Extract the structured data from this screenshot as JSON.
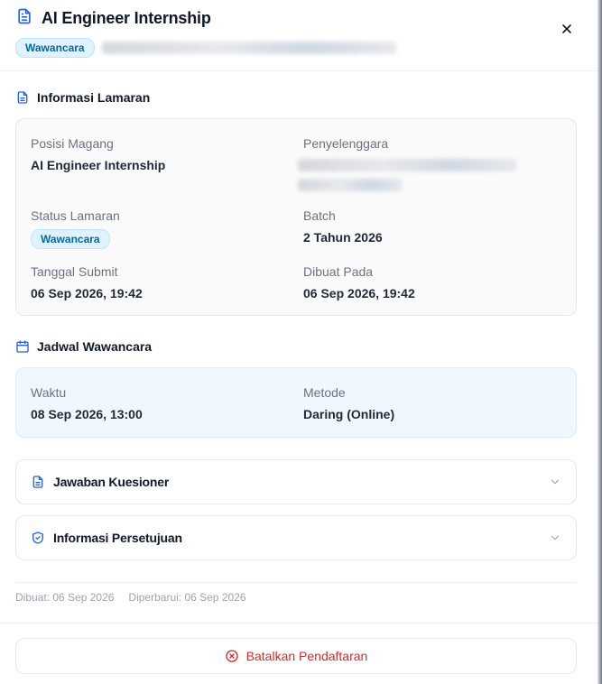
{
  "header": {
    "title": "AI Engineer Internship",
    "status_badge": "Wawancara",
    "close_icon": "close-icon"
  },
  "info": {
    "section_title": "Informasi Lamaran",
    "posisi_label": "Posisi Magang",
    "posisi_value": "AI Engineer Internship",
    "penyelenggara_label": "Penyelenggara",
    "status_label": "Status Lamaran",
    "status_value": "Wawancara",
    "batch_label": "Batch",
    "batch_value": "2 Tahun 2026",
    "submit_label": "Tanggal Submit",
    "submit_value": "06 Sep 2026, 19:42",
    "dibuat_label": "Dibuat Pada",
    "dibuat_value": "06 Sep 2026, 19:42"
  },
  "interview": {
    "section_title": "Jadwal Wawancara",
    "waktu_label": "Waktu",
    "waktu_value": "08 Sep 2026, 13:00",
    "metode_label": "Metode",
    "metode_value": "Daring (Online)"
  },
  "accordions": {
    "kuesioner": "Jawaban Kuesioner",
    "persetujuan": "Informasi Persetujuan"
  },
  "footer": {
    "created": "Dibuat: 06 Sep 2026",
    "updated": "Diperbarui: 06 Sep 2026",
    "cancel_label": "Batalkan Pendaftaran"
  },
  "colors": {
    "accent": "#2563eb",
    "badge_bg": "#e0f2fe",
    "badge_text": "#0369a1",
    "danger": "#dc2626"
  }
}
